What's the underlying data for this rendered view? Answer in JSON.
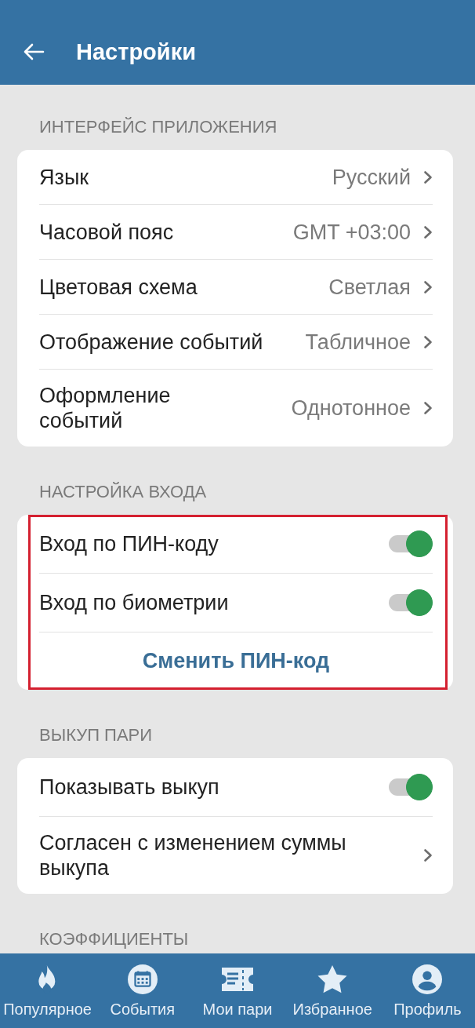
{
  "header": {
    "title": "Настройки"
  },
  "sections": [
    {
      "title": "ИНТЕРФЕЙС ПРИЛОЖЕНИЯ",
      "rows": [
        {
          "kind": "link",
          "label": "Язык",
          "value": "Русский"
        },
        {
          "kind": "link",
          "label": "Часовой пояс",
          "value": "GMT +03:00"
        },
        {
          "kind": "link",
          "label": "Цветовая схема",
          "value": "Светлая"
        },
        {
          "kind": "link",
          "label": "Отображение событий",
          "value": "Табличное"
        },
        {
          "kind": "link",
          "label": "Оформление\nсобытий",
          "value": "Однотонное"
        }
      ]
    },
    {
      "title": "НАСТРОЙКА ВХОДА",
      "highlighted": true,
      "rows": [
        {
          "kind": "toggle",
          "label": "Вход по ПИН-коду",
          "on": true
        },
        {
          "kind": "toggle",
          "label": "Вход по биометрии",
          "on": true
        },
        {
          "kind": "action",
          "label": "Сменить ПИН-код"
        }
      ]
    },
    {
      "title": "ВЫКУП ПАРИ",
      "rows": [
        {
          "kind": "toggle",
          "label": "Показывать выкуп",
          "on": true
        },
        {
          "kind": "link",
          "label": "Согласен с изменением суммы выкупа"
        }
      ]
    },
    {
      "title": "КОЭФФИЦИЕНТЫ"
    }
  ],
  "bottom_nav": [
    {
      "label": "Популярное"
    },
    {
      "label": "События"
    },
    {
      "label": "Мои пари"
    },
    {
      "label": "Избранное"
    },
    {
      "label": "Профиль"
    }
  ]
}
